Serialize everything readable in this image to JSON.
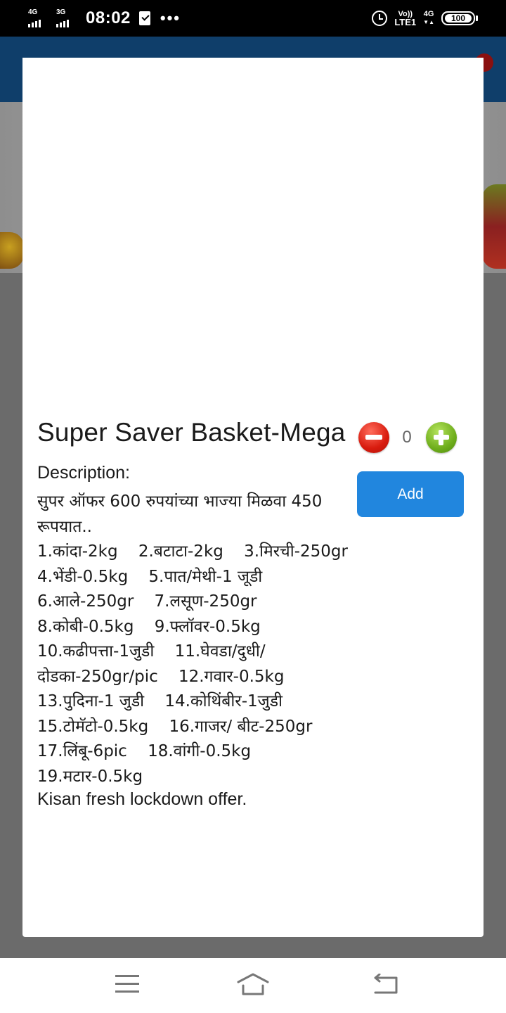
{
  "status_bar": {
    "network1": "4G",
    "network2": "3G",
    "time": "08:02",
    "volte_top": "Vo))",
    "volte_bottom": "LTE1",
    "net_right": "4G",
    "battery": "100"
  },
  "product": {
    "title": "Super Saver Basket-Mega",
    "quantity": "0",
    "add_label": "Add",
    "description_label": "Description:",
    "description": "सुपर ऑफर 600 रुपयांच्या भाज्या मिळवा 450 रूपयात..\n1.कांदा-2kg    2.बटाटा-2kg    3.मिरची-250gr    4.भेंडी-0.5kg    5.पात/मेथी-1 जूडी    6.आले-250gr    7.लसूण-250gr 8.कोबी-0.5kg    9.फ्लॉवर-0.5kg    10.कढीपत्ता-1जुडी    11.घेवडा/दुधी/ दोडका-250gr/pic    12.गवार-0.5kg 13.पुदिना-1 जुडी    14.कोथिंबीर-1जुडी 15.टोमॅटो-0.5kg    16.गाजर/ बीट-250gr 17.लिंबू-6pic    18.वांगी-0.5kg 19.मटार-0.5kg",
    "footer": "Kisan fresh lockdown offer."
  },
  "colors": {
    "add_button": "#2186de",
    "minus_button": "#d81b0e",
    "plus_button": "#6fae1c",
    "app_bar": "#0f3e6a"
  },
  "icons": {
    "minus": "minus-circle-icon",
    "plus": "plus-circle-icon",
    "nav_menu": "menu-icon",
    "nav_home": "home-icon",
    "nav_back": "back-icon"
  }
}
